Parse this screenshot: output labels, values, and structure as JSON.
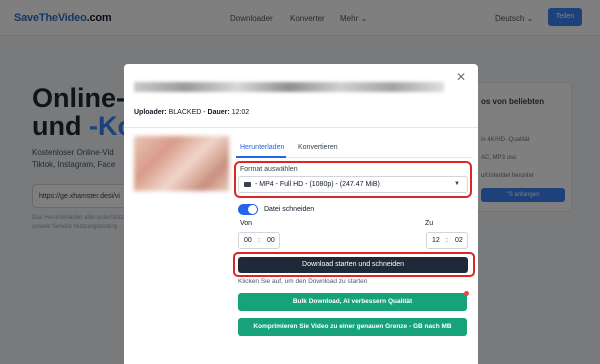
{
  "topnav": {
    "logo_main": "SaveTheVideo",
    "logo_suffix": ".com",
    "links": [
      "Downloader",
      "Konverter",
      "Mehr ⌄"
    ],
    "language": "Deutsch ⌄",
    "button": "Teilen"
  },
  "hero": {
    "title_line1": "Online-V",
    "title_line2_a": "und ",
    "title_line2_b": "-Kor",
    "subtitle": "Kostenloser Online-Vid Tiktok, Instagram, Face",
    "url_value": "https://ge.xhamster.desi/vi",
    "note": "Das Herunterladen aller unterstützt unsere Service  Nutzungsbeding"
  },
  "side_card": {
    "title": "os von beliebten",
    "line1": "in 4K/HD -Qualität",
    "line2": "AC, MP3 uso",
    "line3": "u/Untertitel herunter",
    "button": "\"S anfangen"
  },
  "modal": {
    "uploader_label": "Uploader:",
    "uploader_value": "BLACKED",
    "duration_label": "Dauer:",
    "duration_value": "12:02",
    "tabs": [
      "Herunterladen",
      "Konvertieren"
    ],
    "format_label": "Format auswählen",
    "format_value": "- MP4 - Full HD - (1080p) - (247.47 MiB)",
    "toggle_label": "Datei schneiden",
    "from_label": "Von",
    "to_label": "Zu",
    "from_h": "00",
    "from_m": "00",
    "to_h": "12",
    "to_m": "02",
    "colon": ":",
    "download_button": "Download starten und schneiden",
    "hint": "Klicken Sie auf, um den Download zu starten",
    "bulk_button": "Bulk Download, AI verbessern Qualität",
    "compress_button": "Komprimieren Sie Video zu einer genauen Grenze - GB nach MB"
  },
  "colors": {
    "accent": "#2563eb",
    "highlight": "#dc2626",
    "green": "#16a37a",
    "dark_button": "#1f2937"
  }
}
